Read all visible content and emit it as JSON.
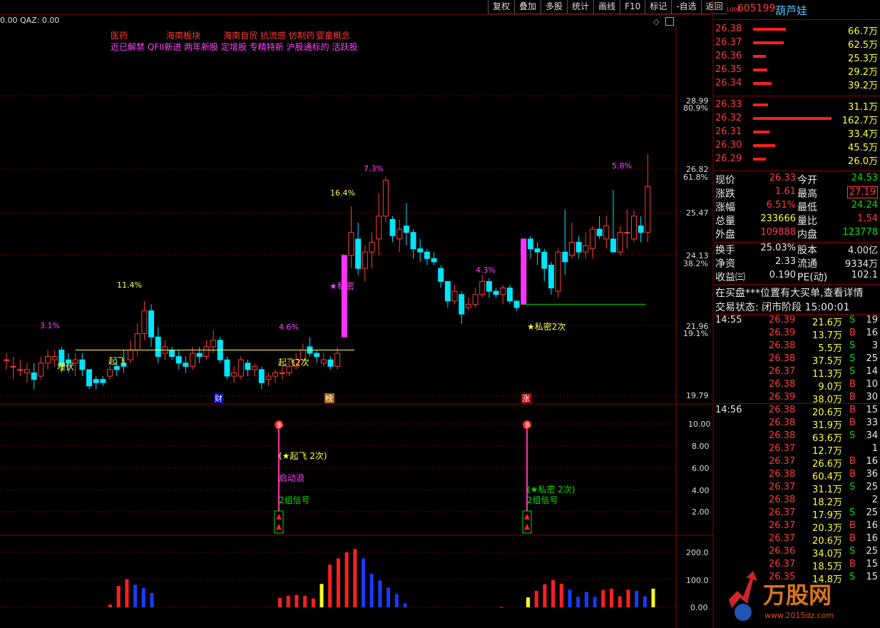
{
  "toolbar": {
    "items": [
      "复权",
      "叠加",
      "多股",
      "统计",
      "画线",
      "F10",
      "标记",
      "-自选",
      "返回"
    ]
  },
  "indicator_header": {
    "text": "0.00  QAZ: 0.00"
  },
  "concepts": {
    "line1": [
      "医药",
      "海南板块",
      "海南自贸",
      "抗流感",
      "仿制药",
      "婴童概念"
    ],
    "line2": "近已解禁 QFII新进 两年新股 定增股 专精特新 沪股通标的 活跃股"
  },
  "price_axis": {
    "labels": [
      "28.99",
      "80.9%",
      "26.82",
      "61.8%",
      "25.47",
      "24.13",
      "38.2%",
      "21.96",
      "19.1%",
      "19.79"
    ]
  },
  "kline_labels": {
    "pct": [
      "3.1%",
      "11.4%",
      "4.6%",
      "16.4%",
      "7.3%",
      "4.3%",
      "5.8%"
    ],
    "signals": [
      "埋伏",
      "起飞",
      "起飞2次",
      "★私密",
      "★私密2次"
    ],
    "events": [
      "财",
      "榜",
      "涨"
    ]
  },
  "indicator2": {
    "axis": [
      "10.00",
      "8.00",
      "6.00",
      "4.00",
      "2.00"
    ],
    "badge": "多",
    "texts_a": [
      "(★起飞 2次)",
      "启动浪",
      "2组信号"
    ],
    "texts_b": [
      "(★私密 2次)",
      "2组信号"
    ]
  },
  "indicator3": {
    "axis": [
      "200.0",
      "100.0",
      "0.00"
    ]
  },
  "quote": {
    "code": "605199",
    "name": "葫芦娃",
    "asks": [
      {
        "price": "26.38",
        "vol": "66.7万",
        "bar": 0.42
      },
      {
        "price": "26.37",
        "vol": "62.5万",
        "bar": 0.39
      },
      {
        "price": "26.36",
        "vol": "25.3万",
        "bar": 0.16
      },
      {
        "price": "26.35",
        "vol": "29.2万",
        "bar": 0.18
      },
      {
        "price": "26.34",
        "vol": "39.2万",
        "bar": 0.24
      }
    ],
    "bids": [
      {
        "price": "26.33",
        "vol": "31.1万",
        "bar": 0.19
      },
      {
        "price": "26.32",
        "vol": "162.7万",
        "bar": 1.0
      },
      {
        "price": "26.31",
        "vol": "33.4万",
        "bar": 0.21
      },
      {
        "price": "26.30",
        "vol": "45.5万",
        "bar": 0.28
      },
      {
        "price": "26.29",
        "vol": "26.0万",
        "bar": 0.16
      }
    ],
    "stats": [
      {
        "l1": "现价",
        "v1": "26.33",
        "c1": "red",
        "l2": "今开",
        "v2": "24.53",
        "c2": "grn"
      },
      {
        "l1": "涨跌",
        "v1": "1.61",
        "c1": "red",
        "l2": "最高",
        "v2": "27.19",
        "c2": "red"
      },
      {
        "l1": "涨幅",
        "v1": "6.51%",
        "c1": "red",
        "l2": "最低",
        "v2": "24.24",
        "c2": "grn"
      },
      {
        "l1": "总量",
        "v1": "233666",
        "c1": "yel",
        "l2": "量比",
        "v2": "1.54",
        "c2": "red"
      },
      {
        "l1": "外盘",
        "v1": "109888",
        "c1": "red",
        "l2": "内盘",
        "v2": "123778",
        "c2": "grn"
      }
    ],
    "stats2": [
      {
        "l1": "换手",
        "v1": "25.03%",
        "l2": "股本",
        "v2": "4.00亿"
      },
      {
        "l1": "净资",
        "v1": "2.33",
        "l2": "流通",
        "v2": "9334万"
      },
      {
        "l1": "收益㈢",
        "v1": "0.190",
        "l2": "PE(动)",
        "v2": "102.1"
      }
    ],
    "notice": "在买盘***位置有大买单,查看详情",
    "status": "交易状态: 闭市阶段 15:00:01"
  },
  "ticks": {
    "t1": "14:55",
    "t2": "14:56",
    "rows1": [
      {
        "p": "26.39",
        "v": "21.6万",
        "d": "S",
        "n": "19"
      },
      {
        "p": "26.39",
        "v": "13.7万",
        "d": "B",
        "n": "16"
      },
      {
        "p": "26.38",
        "v": "5.5万",
        "d": "S",
        "n": "3"
      },
      {
        "p": "26.38",
        "v": "37.5万",
        "d": "S",
        "n": "25"
      },
      {
        "p": "26.37",
        "v": "11.3万",
        "d": "S",
        "n": "14"
      },
      {
        "p": "26.38",
        "v": "9.0万",
        "d": "B",
        "n": "10"
      },
      {
        "p": "26.39",
        "v": "38.0万",
        "d": "B",
        "n": "30"
      }
    ],
    "rows2": [
      {
        "p": "26.38",
        "v": "20.6万",
        "d": "B",
        "n": "15"
      },
      {
        "p": "26.38",
        "v": "31.9万",
        "d": "B",
        "n": "33"
      },
      {
        "p": "26.38",
        "v": "63.6万",
        "d": "S",
        "n": "34"
      },
      {
        "p": "26.37",
        "v": "12.7万",
        "d": "",
        "n": "1"
      },
      {
        "p": "26.37",
        "v": "26.6万",
        "d": "B",
        "n": "16"
      },
      {
        "p": "26.38",
        "v": "60.4万",
        "d": "B",
        "n": "36"
      },
      {
        "p": "26.37",
        "v": "31.1万",
        "d": "S",
        "n": "25"
      },
      {
        "p": "26.38",
        "v": "18.2万",
        "d": "",
        "n": "2"
      },
      {
        "p": "26.37",
        "v": "17.9万",
        "d": "S",
        "n": "25"
      },
      {
        "p": "26.37",
        "v": "20.3万",
        "d": "B",
        "n": "16"
      },
      {
        "p": "26.37",
        "v": "20.6万",
        "d": "B",
        "n": "16"
      },
      {
        "p": "26.36",
        "v": "34.0万",
        "d": "S",
        "n": "25"
      },
      {
        "p": "26.37",
        "v": "18.5万",
        "d": "B",
        "n": "15"
      },
      {
        "p": "26.35",
        "v": "14.8万",
        "d": "S",
        "n": "15"
      }
    ]
  },
  "watermark": {
    "text": "万股网",
    "url": "www.2015dz.com"
  },
  "chart_data": {
    "type": "candlestick",
    "price_range": [
      19.79,
      28.99
    ],
    "candles": [
      [
        20.9,
        20.9,
        20.6,
        21.1
      ],
      [
        20.7,
        20.7,
        20.3,
        21.0
      ],
      [
        20.6,
        20.6,
        20.4,
        20.9
      ],
      [
        20.5,
        20.6,
        20.2,
        20.8
      ],
      [
        20.5,
        20.3,
        20.0,
        20.8
      ],
      [
        20.4,
        20.8,
        20.3,
        21.0
      ],
      [
        20.8,
        21.0,
        20.6,
        21.2
      ],
      [
        20.9,
        21.0,
        20.7,
        21.2
      ],
      [
        21.2,
        20.7,
        20.5,
        21.3
      ],
      [
        20.9,
        20.8,
        20.5,
        21.1
      ],
      [
        20.8,
        20.9,
        20.4,
        21.1
      ],
      [
        20.9,
        20.6,
        20.4,
        21.1
      ],
      [
        20.6,
        20.1,
        20.0,
        20.6
      ],
      [
        20.3,
        20.2,
        20.0,
        20.4
      ],
      [
        20.3,
        20.2,
        20.1,
        20.4
      ],
      [
        20.4,
        20.6,
        20.3,
        20.7
      ],
      [
        20.7,
        20.6,
        20.4,
        20.9
      ],
      [
        20.8,
        20.7,
        20.5,
        21.2
      ],
      [
        20.9,
        21.2,
        20.8,
        21.5
      ],
      [
        21.2,
        21.7,
        21.0,
        22.0
      ],
      [
        21.7,
        22.4,
        21.5,
        22.7
      ],
      [
        22.4,
        21.6,
        21.3,
        22.6
      ],
      [
        21.6,
        21.0,
        20.8,
        21.9
      ],
      [
        21.1,
        21.3,
        20.9,
        21.5
      ],
      [
        21.2,
        21.0,
        20.9,
        21.3
      ],
      [
        21.0,
        20.8,
        20.6,
        21.2
      ],
      [
        20.8,
        20.7,
        20.5,
        21.0
      ],
      [
        20.7,
        21.1,
        20.6,
        21.3
      ],
      [
        21.1,
        21.0,
        20.8,
        21.3
      ],
      [
        21.0,
        21.3,
        20.9,
        21.5
      ],
      [
        21.3,
        21.5,
        21.1,
        21.8
      ],
      [
        21.5,
        20.9,
        20.8,
        21.6
      ],
      [
        20.9,
        20.4,
        20.3,
        21.0
      ],
      [
        20.4,
        20.5,
        20.2,
        20.7
      ],
      [
        20.4,
        20.9,
        20.3,
        21.0
      ],
      [
        20.8,
        20.6,
        20.4,
        20.9
      ],
      [
        20.6,
        20.7,
        20.4,
        20.8
      ],
      [
        20.6,
        20.2,
        20.0,
        20.7
      ],
      [
        20.3,
        20.4,
        20.1,
        20.5
      ],
      [
        20.4,
        20.5,
        20.2,
        20.6
      ],
      [
        20.5,
        20.5,
        20.3,
        20.7
      ],
      [
        20.5,
        20.7,
        20.4,
        20.9
      ],
      [
        20.7,
        20.9,
        20.6,
        21.1
      ],
      [
        20.9,
        21.2,
        20.8,
        21.4
      ],
      [
        21.3,
        21.1,
        21.0,
        21.6
      ],
      [
        21.1,
        21.0,
        20.8,
        21.2
      ],
      [
        20.8,
        20.9,
        20.7,
        21.1
      ],
      [
        20.9,
        20.7,
        20.6,
        21.0
      ],
      [
        20.7,
        21.1,
        20.6,
        21.3
      ],
      [
        21.6,
        24.1,
        21.6,
        24.1
      ],
      [
        24.1,
        24.8,
        23.7,
        25.6
      ],
      [
        24.6,
        23.7,
        23.5,
        25.1
      ],
      [
        23.7,
        24.2,
        23.3,
        24.4
      ],
      [
        24.2,
        24.5,
        23.7,
        24.8
      ],
      [
        24.6,
        25.3,
        24.1,
        26.0
      ],
      [
        25.3,
        26.4,
        25.1,
        26.5
      ],
      [
        25.2,
        24.7,
        24.5,
        25.3
      ],
      [
        24.6,
        24.9,
        24.2,
        25.2
      ],
      [
        25.0,
        24.8,
        24.4,
        25.7
      ],
      [
        24.8,
        24.3,
        24.0,
        24.9
      ],
      [
        24.3,
        24.2,
        23.9,
        24.6
      ],
      [
        24.2,
        24.0,
        23.8,
        24.3
      ],
      [
        24.0,
        23.9,
        23.8,
        24.2
      ],
      [
        23.7,
        23.3,
        23.1,
        23.8
      ],
      [
        23.3,
        22.7,
        22.5,
        23.3
      ],
      [
        22.7,
        23.0,
        22.6,
        23.2
      ],
      [
        22.9,
        22.3,
        22.0,
        23.0
      ],
      [
        22.5,
        22.6,
        22.4,
        22.8
      ],
      [
        22.6,
        22.9,
        22.5,
        23.1
      ],
      [
        22.9,
        23.3,
        22.8,
        23.5
      ],
      [
        23.3,
        23.0,
        22.8,
        23.4
      ],
      [
        23.0,
        22.9,
        22.8,
        23.1
      ],
      [
        22.9,
        23.1,
        22.6,
        23.2
      ],
      [
        23.1,
        22.7,
        22.6,
        23.2
      ],
      [
        22.7,
        22.5,
        22.4,
        22.7
      ],
      [
        22.6,
        24.6,
        22.6,
        24.6
      ],
      [
        24.6,
        24.3,
        24.0,
        24.7
      ],
      [
        24.3,
        24.2,
        23.8,
        24.5
      ],
      [
        24.2,
        23.7,
        23.3,
        24.3
      ],
      [
        23.8,
        23.1,
        22.9,
        23.9
      ],
      [
        23.0,
        24.2,
        22.8,
        24.3
      ],
      [
        24.2,
        23.9,
        23.5,
        25.5
      ],
      [
        24.1,
        24.5,
        24.0,
        25.1
      ],
      [
        24.5,
        24.2,
        24.0,
        24.7
      ],
      [
        24.2,
        24.4,
        24.0,
        24.8
      ],
      [
        24.3,
        24.9,
        24.0,
        25.0
      ],
      [
        24.9,
        24.7,
        24.6,
        25.3
      ],
      [
        24.6,
        25.0,
        24.3,
        25.3
      ],
      [
        24.6,
        24.2,
        24.2,
        26.1
      ],
      [
        24.2,
        24.8,
        24.1,
        25.0
      ],
      [
        24.8,
        24.8,
        24.3,
        25.5
      ],
      [
        24.6,
        25.3,
        24.5,
        25.5
      ],
      [
        25.0,
        24.8,
        24.5,
        25.3
      ],
      [
        24.8,
        26.2,
        24.5,
        27.2
      ]
    ],
    "yellow_line": 21.2,
    "green_line": 22.6,
    "signal_a": [
      8.8,
      7.2,
      5.8,
      3.9,
      2.2
    ],
    "signal_b": [
      8.8,
      6.1,
      3.9,
      2.0
    ],
    "volume_bars": [
      {
        "v": 10,
        "c": "red"
      },
      {
        "v": 78,
        "c": "red"
      },
      {
        "v": 102,
        "c": "red"
      },
      {
        "v": 82,
        "c": "blue"
      },
      {
        "v": 70,
        "c": "blue"
      },
      {
        "v": 52,
        "c": "blue"
      },
      {
        "v": 34,
        "c": "red"
      },
      {
        "v": 42,
        "c": "red"
      },
      {
        "v": 45,
        "c": "red"
      },
      {
        "v": 42,
        "c": "red"
      },
      {
        "v": 32,
        "c": "red"
      },
      {
        "v": 85,
        "c": "yellow"
      },
      {
        "v": 155,
        "c": "red"
      },
      {
        "v": 178,
        "c": "red"
      },
      {
        "v": 200,
        "c": "red"
      },
      {
        "v": 212,
        "c": "red"
      },
      {
        "v": 178,
        "c": "blue"
      },
      {
        "v": 122,
        "c": "blue"
      },
      {
        "v": 98,
        "c": "blue"
      },
      {
        "v": 72,
        "c": "blue"
      },
      {
        "v": 48,
        "c": "blue"
      },
      {
        "v": 14,
        "c": "blue"
      },
      {
        "v": 36,
        "c": "yellow"
      },
      {
        "v": 60,
        "c": "red"
      },
      {
        "v": 84,
        "c": "red"
      },
      {
        "v": 99,
        "c": "red"
      },
      {
        "v": 86,
        "c": "red"
      },
      {
        "v": 64,
        "c": "blue"
      },
      {
        "v": 38,
        "c": "blue"
      },
      {
        "v": 56,
        "c": "blue"
      },
      {
        "v": 38,
        "c": "blue"
      },
      {
        "v": 63,
        "c": "red"
      },
      {
        "v": 68,
        "c": "red"
      },
      {
        "v": 40,
        "c": "red"
      },
      {
        "v": 64,
        "c": "red"
      },
      {
        "v": 60,
        "c": "blue"
      },
      {
        "v": 40,
        "c": "blue"
      },
      {
        "v": 68,
        "c": "yellow"
      }
    ]
  }
}
